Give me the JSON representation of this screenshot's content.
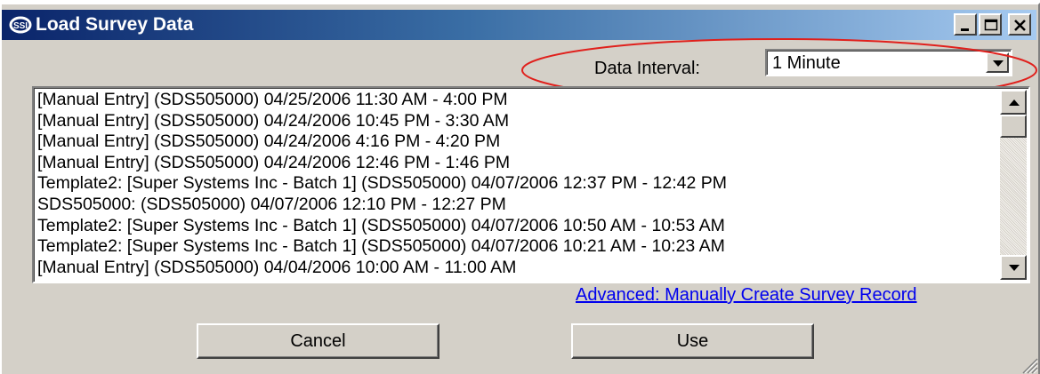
{
  "window": {
    "title": "Load Survey Data",
    "icon": "app-logo-icon",
    "controls": [
      "minimize-icon",
      "maximize-icon",
      "close-icon"
    ]
  },
  "data_interval": {
    "label": "Data Interval:",
    "value": "1 Minute"
  },
  "survey_list": {
    "items": [
      "[Manual Entry]  (SDS505000) 04/25/2006 11:30 AM - 4:00 PM",
      "[Manual Entry]  (SDS505000) 04/24/2006 10:45 PM - 3:30 AM",
      "[Manual Entry]  (SDS505000) 04/24/2006 4:16 PM - 4:20 PM",
      "[Manual Entry]  (SDS505000) 04/24/2006 12:46 PM - 1:46 PM",
      "Template2: [Super Systems Inc - Batch 1]  (SDS505000) 04/07/2006 12:37 PM - 12:42 PM",
      "SDS505000:  (SDS505000) 04/07/2006 12:10 PM - 12:27 PM",
      "Template2: [Super Systems Inc - Batch 1]  (SDS505000) 04/07/2006 10:50 AM - 10:53 AM",
      "Template2: [Super Systems Inc - Batch 1]  (SDS505000) 04/07/2006 10:21 AM - 10:23 AM",
      "[Manual Entry]  (SDS505000) 04/04/2006 10:00 AM - 11:00 AM"
    ]
  },
  "advanced_link": "Advanced: Manually Create Survey Record",
  "buttons": {
    "cancel": "Cancel",
    "use": "Use"
  },
  "colors": {
    "title_gradient_start": "#0a246a",
    "title_gradient_end": "#a6caf0",
    "highlight_ellipse": "#e0201c",
    "link": "#0000ee",
    "face": "#d4d0c8"
  }
}
